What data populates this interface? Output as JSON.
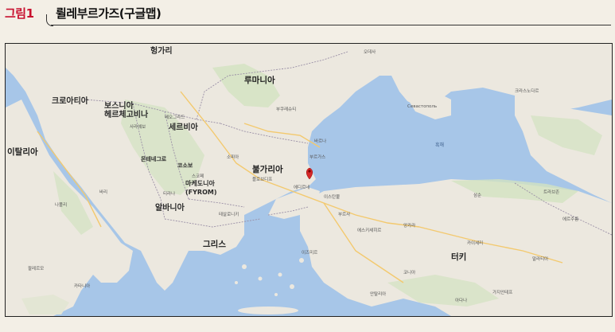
{
  "header": {
    "figure_label": "그림1",
    "title": "륄레부르가즈(구글맵)"
  },
  "map": {
    "marker": "map-pin-icon",
    "countries": [
      {
        "key": "hungary",
        "text": "헝가리"
      },
      {
        "key": "romania",
        "text": "루마니아"
      },
      {
        "key": "croatia",
        "text": "크로아티아"
      },
      {
        "key": "bosnia",
        "text": "보스니아\n헤르체고비나"
      },
      {
        "key": "serbia",
        "text": "세르비아"
      },
      {
        "key": "italy",
        "text": "이탈리아"
      },
      {
        "key": "bulgaria",
        "text": "불가리아"
      },
      {
        "key": "macedonia",
        "text": "마케도니아\n(FYROM)"
      },
      {
        "key": "albania",
        "text": "알바니아"
      },
      {
        "key": "greece",
        "text": "그리스"
      },
      {
        "key": "turkey",
        "text": "터키"
      },
      {
        "key": "montenegro",
        "text": "몬테네그로"
      },
      {
        "key": "kosovo",
        "text": "코소보"
      }
    ],
    "cities": [
      {
        "key": "istanbul",
        "text": "이스탄불"
      },
      {
        "key": "ankara",
        "text": "앙카라"
      },
      {
        "key": "sofia",
        "text": "소피아"
      },
      {
        "key": "bucharest",
        "text": "부쿠레슈티"
      },
      {
        "key": "sevastopol",
        "text": "Севастополь"
      },
      {
        "key": "krasnodar",
        "text": "크라스노다르"
      },
      {
        "key": "izmir",
        "text": "이즈미르"
      },
      {
        "key": "konya",
        "text": "코니아"
      },
      {
        "key": "antalya",
        "text": "안탈리아"
      },
      {
        "key": "adana",
        "text": "아다나"
      },
      {
        "key": "gaziantep",
        "text": "가지안테프"
      },
      {
        "key": "palermo",
        "text": "팔레르모"
      },
      {
        "key": "napoli",
        "text": "나폴리"
      },
      {
        "key": "trabzon",
        "text": "트라브존"
      },
      {
        "key": "erzurum",
        "text": "에르주룸"
      },
      {
        "key": "odessa",
        "text": "오데사"
      },
      {
        "key": "eskisehir",
        "text": "에스키셰히르"
      },
      {
        "key": "samsun",
        "text": "삼순"
      },
      {
        "key": "tirana",
        "text": "티라나"
      },
      {
        "key": "skopje",
        "text": "스코페"
      },
      {
        "key": "belgrade",
        "text": "베오그라드"
      },
      {
        "key": "sarajevo",
        "text": "사라예보"
      },
      {
        "key": "thessaloniki",
        "text": "테살로니키"
      },
      {
        "key": "varna",
        "text": "바르나"
      },
      {
        "key": "burgas",
        "text": "부르가스"
      },
      {
        "key": "plovdiv",
        "text": "플로브디프"
      },
      {
        "key": "catania",
        "text": "카타니아"
      },
      {
        "key": "bari",
        "text": "바리"
      },
      {
        "key": "malatya",
        "text": "말라티아"
      },
      {
        "key": "kayseri",
        "text": "카이세리"
      },
      {
        "key": "bursa",
        "text": "부르사"
      },
      {
        "key": "edirne",
        "text": "에디르네"
      }
    ],
    "seas": [
      {
        "key": "black_sea",
        "text": "흑해"
      }
    ],
    "colors": {
      "sea": "#a7c6e8",
      "land": "#ece8df",
      "green": "#d3e2c0",
      "border": "#9a8fa6",
      "marker": "#d62828",
      "accent_red": "#c8102e"
    }
  }
}
